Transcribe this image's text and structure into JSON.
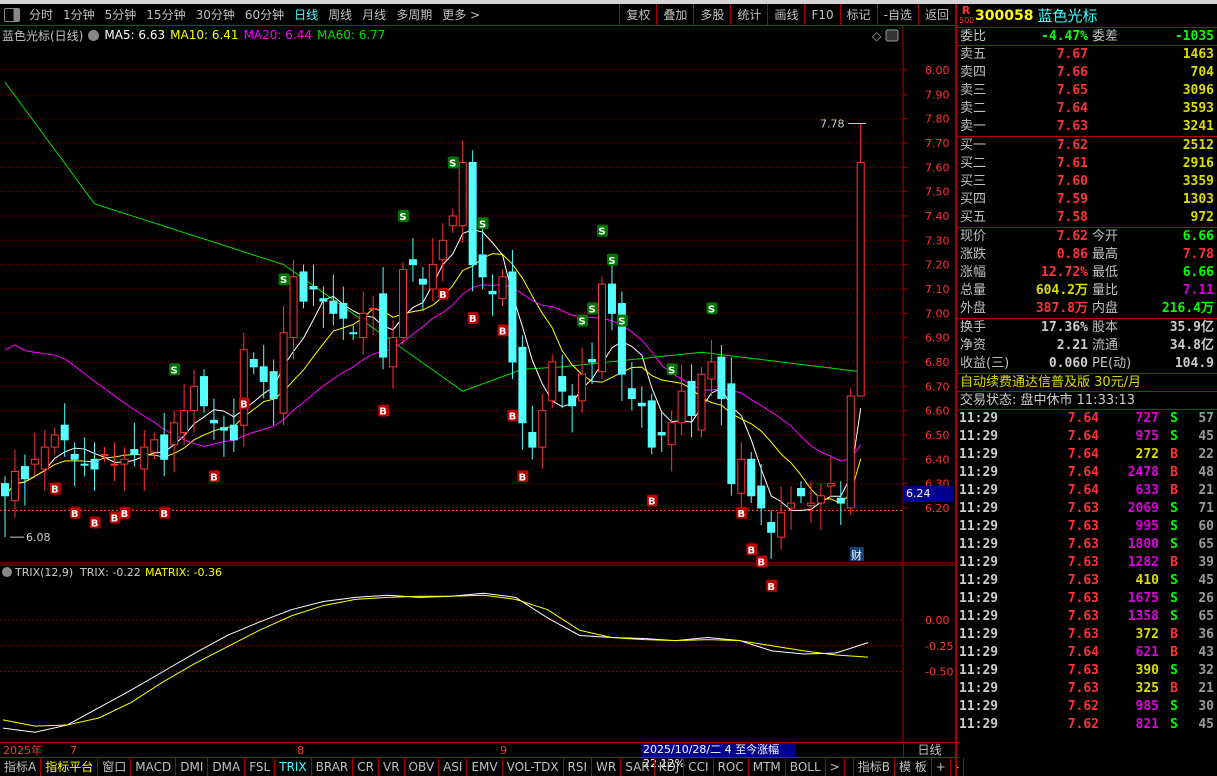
{
  "toolbar": {
    "tabs": [
      "分时",
      "1分钟",
      "5分钟",
      "15分钟",
      "30分钟",
      "60分钟",
      "日线",
      "周线",
      "月线",
      "多周期",
      "更多 >"
    ],
    "active": "日线",
    "right_buttons": [
      "复权",
      "叠加",
      "多股",
      "统计",
      "画线",
      "F10",
      "标记",
      "-自选",
      "返回"
    ]
  },
  "info": {
    "title": "蓝色光标(日线)",
    "ma5": "MA5: 6.63",
    "ma10": "MA10: 6.41",
    "ma20": "MA20: 6.44",
    "ma60": "MA60: 6.77"
  },
  "trix_info": {
    "title": "TRIX(12,9)",
    "trix": "TRIX: -0.22",
    "matrix": "MATRIX: -0.36"
  },
  "colors": {
    "up": "#ff3333",
    "down": "#54ffff",
    "ma5": "#ffffff",
    "ma10": "#ffff00",
    "ma20": "#ff00ff",
    "ma60": "#00dd00",
    "grid": "#aa0000"
  },
  "chart_data": [
    {
      "type": "candlestick",
      "title": "蓝色光标(日线)",
      "ylim": [
        6.0,
        8.1
      ],
      "yticks": [
        "8.00",
        "7.90",
        "7.80",
        "7.70",
        "7.60",
        "7.50",
        "7.40",
        "7.30",
        "7.20",
        "7.10",
        "7.00",
        "6.90",
        "6.80",
        "6.70",
        "6.60",
        "6.50",
        "6.40",
        "6.30",
        "6.20"
      ],
      "closes": [
        6.25,
        6.35,
        6.32,
        6.4,
        6.45,
        6.5,
        6.48,
        6.4,
        6.38,
        6.36,
        6.42,
        6.38,
        6.4,
        6.42,
        6.45,
        6.48,
        6.4,
        6.55,
        6.6,
        6.7,
        6.62,
        6.55,
        6.52,
        6.48,
        6.85,
        6.78,
        6.72,
        6.65,
        6.92,
        7.15,
        7.05,
        7.1,
        7.05,
        7.0,
        6.98,
        6.92,
        7.0,
        7.02,
        6.82,
        6.9,
        7.18,
        7.2,
        7.12,
        7.2,
        7.3,
        7.4,
        7.62,
        7.2,
        7.15,
        7.08,
        7.15,
        6.8,
        6.55,
        6.45,
        6.6,
        6.8,
        6.68,
        6.62,
        6.75,
        6.8,
        7.12,
        7.0,
        6.75,
        6.65,
        6.62,
        6.45,
        6.5,
        6.55,
        6.68,
        6.58,
        6.75,
        6.8,
        6.65,
        6.3,
        6.4,
        6.25,
        6.2,
        6.1,
        6.18,
        6.22,
        6.25,
        6.22,
        6.25,
        6.3,
        6.22,
        6.66,
        7.62
      ],
      "last": {
        "open": 6.66,
        "high": 7.78,
        "low": 6.66
      },
      "ma60": [
        [
          0,
          7.95
        ],
        [
          9,
          7.45
        ],
        [
          28,
          7.2
        ],
        [
          46,
          6.68
        ],
        [
          52,
          6.77
        ],
        [
          56,
          6.78
        ],
        [
          70,
          6.84
        ],
        [
          86,
          6.76
        ]
      ],
      "signals": {
        "S": [
          17,
          28,
          40,
          45,
          48,
          58,
          59,
          60,
          61,
          62,
          67,
          71
        ],
        "B": [
          5,
          7,
          9,
          11,
          12,
          16,
          21,
          24,
          38,
          44,
          47,
          50,
          51,
          52,
          65,
          74,
          75,
          76,
          77
        ]
      },
      "annotations": {
        "high_label": "7.78",
        "low_label": "6.08",
        "current_price": "6.24",
        "fin_marker": "财"
      }
    },
    {
      "type": "line",
      "title": "TRIX(12,9)",
      "yticks": [
        "0.00",
        "-0.25",
        "-0.50"
      ],
      "series": [
        {
          "name": "TRIX",
          "values": [
            -1.05,
            -1.09,
            -1.02,
            -0.85,
            -0.68,
            -0.5,
            -0.32,
            -0.15,
            -0.02,
            0.1,
            0.18,
            0.22,
            0.24,
            0.22,
            0.23,
            0.26,
            0.22,
            0.02,
            -0.15,
            -0.17,
            -0.18,
            -0.2,
            -0.17,
            -0.2,
            -0.3,
            -0.33,
            -0.32,
            -0.22
          ]
        },
        {
          "name": "MATRIX",
          "values": [
            -0.97,
            -1.03,
            -1.02,
            -0.95,
            -0.8,
            -0.6,
            -0.42,
            -0.26,
            -0.1,
            0.04,
            0.14,
            0.2,
            0.22,
            0.23,
            0.23,
            0.24,
            0.2,
            0.1,
            -0.1,
            -0.17,
            -0.19,
            -0.2,
            -0.19,
            -0.2,
            -0.25,
            -0.3,
            -0.34,
            -0.36
          ]
        }
      ]
    }
  ],
  "date_axis": {
    "year": "2025年",
    "months": [
      "7",
      "8",
      "9"
    ],
    "cursor_info": "2025/10/28/二 4 至今涨幅22.12%",
    "period": "日线"
  },
  "bottom_tabs": [
    "指标A",
    "指标平台",
    "窗口",
    "MACD",
    "DMI",
    "DMA",
    "FSL",
    "TRIX",
    "BRAR",
    "CR",
    "VR",
    "OBV",
    "ASI",
    "EMV",
    "VOL-TDX",
    "RSI",
    "WR",
    "SAR",
    "KDJ",
    "CCI",
    "ROC",
    "MTM",
    "BOLL",
    ">",
    "",
    "指标B",
    "模 板",
    "+",
    "-"
  ],
  "quote": {
    "logo_top": "R",
    "logo_bottom": "500",
    "code": "300058",
    "name": "蓝色光标",
    "weibi_label": "委比",
    "weibi": "-4.47%",
    "weicha_label": "委差",
    "weicha": "-1035",
    "asks": [
      {
        "label": "卖五",
        "price": "7.67",
        "vol": "1463"
      },
      {
        "label": "卖四",
        "price": "7.66",
        "vol": "704"
      },
      {
        "label": "卖三",
        "price": "7.65",
        "vol": "3096"
      },
      {
        "label": "卖二",
        "price": "7.64",
        "vol": "3593"
      },
      {
        "label": "卖一",
        "price": "7.63",
        "vol": "3241"
      }
    ],
    "bids": [
      {
        "label": "买一",
        "price": "7.62",
        "vol": "2512"
      },
      {
        "label": "买二",
        "price": "7.61",
        "vol": "2916"
      },
      {
        "label": "买三",
        "price": "7.60",
        "vol": "3359"
      },
      {
        "label": "买四",
        "price": "7.59",
        "vol": "1303"
      },
      {
        "label": "买五",
        "price": "7.58",
        "vol": "972"
      }
    ],
    "stats": [
      [
        "现价",
        "7.62",
        "red",
        "今开",
        "6.66",
        "grn"
      ],
      [
        "涨跌",
        "0.86",
        "red",
        "最高",
        "7.78",
        "red"
      ],
      [
        "涨幅",
        "12.72%",
        "red",
        "最低",
        "6.66",
        "grn"
      ],
      [
        "总量",
        "604.2万",
        "yel",
        "量比",
        "7.11",
        "mag"
      ],
      [
        "外盘",
        "387.8万",
        "red",
        "内盘",
        "216.4万",
        "grn"
      ]
    ],
    "fund": [
      [
        "换手",
        "17.36%",
        "股本",
        "35.9亿"
      ],
      [
        "净资",
        "2.21",
        "流通",
        "34.8亿"
      ],
      [
        "收益(三)",
        "0.060",
        "PE(动)",
        "104.9"
      ]
    ],
    "ad": "自动续费通达信普及版  30元/月",
    "status": "交易状态: 盘中休市 11:33:13"
  },
  "trades": [
    [
      "11:29",
      "7.64",
      "727",
      "S",
      "57"
    ],
    [
      "11:29",
      "7.64",
      "975",
      "S",
      "45"
    ],
    [
      "11:29",
      "7.64",
      "272",
      "B",
      "22"
    ],
    [
      "11:29",
      "7.64",
      "2478",
      "B",
      "48"
    ],
    [
      "11:29",
      "7.64",
      "633",
      "B",
      "21"
    ],
    [
      "11:29",
      "7.63",
      "2069",
      "S",
      "71"
    ],
    [
      "11:29",
      "7.63",
      "995",
      "S",
      "60"
    ],
    [
      "11:29",
      "7.63",
      "1800",
      "S",
      "65"
    ],
    [
      "11:29",
      "7.63",
      "1282",
      "B",
      "39"
    ],
    [
      "11:29",
      "7.63",
      "410",
      "S",
      "45"
    ],
    [
      "11:29",
      "7.63",
      "1675",
      "S",
      "26"
    ],
    [
      "11:29",
      "7.63",
      "1358",
      "S",
      "65"
    ],
    [
      "11:29",
      "7.63",
      "372",
      "B",
      "36"
    ],
    [
      "11:29",
      "7.64",
      "621",
      "B",
      "43"
    ],
    [
      "11:29",
      "7.63",
      "390",
      "S",
      "32"
    ],
    [
      "11:29",
      "7.63",
      "325",
      "B",
      "21"
    ],
    [
      "11:29",
      "7.62",
      "985",
      "S",
      "30"
    ],
    [
      "11:29",
      "7.62",
      "821",
      "S",
      "45"
    ]
  ]
}
